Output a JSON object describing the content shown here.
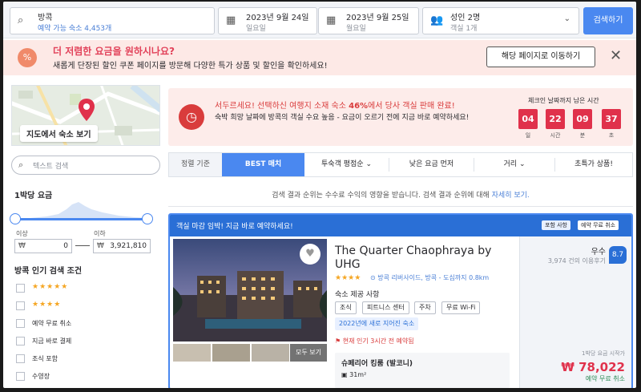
{
  "search": {
    "destination": "방콕",
    "destination_sub": "예약 가능 숙소 4,453개",
    "checkin": "2023년 9월 24일",
    "checkin_day": "일요일",
    "checkout": "2023년 9월 25일",
    "checkout_day": "월요일",
    "guests": "성인 2명",
    "rooms": "객실 1개",
    "button": "검색하기"
  },
  "promo": {
    "title": "더 저렴한 요금을 원하시나요?",
    "text": "새롭게 단장된 할인 쿠폰 페이지를 방문해 다양한 특가 상품 및 할인을 확인하세요!",
    "button": "해당 페이지로 이동하기"
  },
  "sidebar": {
    "map_label": "지도에서 숙소 보기",
    "search_placeholder": "텍스트 검색",
    "price_title": "1박당 요금",
    "min_label": "이상",
    "max_label": "이하",
    "currency": "₩",
    "min_value": "0",
    "max_value": "3,921,810",
    "popular_title": "방콕 인기 검색 조건",
    "filters": [
      {
        "label": "",
        "stars": "★★★★★"
      },
      {
        "label": "",
        "stars": "★★★★"
      },
      {
        "label": "예약 무료 취소",
        "stars": ""
      },
      {
        "label": "지금 바로 결제",
        "stars": ""
      },
      {
        "label": "조식 포함",
        "stars": ""
      },
      {
        "label": "수영장",
        "stars": ""
      }
    ]
  },
  "urgency": {
    "title_prefix": "서두르세요! 선택하신 여행지 소재 숙소 ",
    "title_pct": "46%",
    "title_suffix": "에서 당사 객실 판매 완료!",
    "text": "숙박 희망 날짜에 방콕의 객실 수요 높음 - 요금이 오르기 전에 지금 바로 예약하세요!",
    "countdown_title": "체크인 날짜까지 남은 시간",
    "countdown": [
      {
        "value": "04",
        "unit": "일"
      },
      {
        "value": "22",
        "unit": "시간"
      },
      {
        "value": "09",
        "unit": "분"
      },
      {
        "value": "37",
        "unit": "초"
      }
    ]
  },
  "sort": {
    "label": "정렬 기준",
    "tabs": [
      "BEST 매치",
      "투숙객 평점순",
      "낮은 요금 먼저",
      "거리",
      "초특가 상품!"
    ],
    "active_index": 0
  },
  "note": {
    "text": "검색 결과 순위는 수수료 수익의 영향을 받습니다. 검색 결과 순위에 대해 ",
    "link": "자세히 보기."
  },
  "hotel": {
    "banner": "객실 마감 임박! 지금 바로 예약하세요!",
    "pill_included": "포함 사항",
    "pill_free_cancel": "예약 무료 취소",
    "name_line1": "The Quarter Chaophraya by",
    "name_line2": "UHG",
    "stars": "★★★★",
    "location": "방콕 리버사이드, 방콕 - 도심까지 0.8km",
    "facilities_title": "숙소 제공 사항",
    "facilities": [
      "조식",
      "피트니스 센터",
      "주차",
      "무료 Wi-Fi"
    ],
    "built": "2022년에 새로 지어진 숙소",
    "popular": "현재 인기 3시간 전 예약됨",
    "view_all_photos": "모두 보기",
    "room_name": "슈페리어 킹룸 (발코니)",
    "room_size": "31m²",
    "grade": "우수",
    "reviews": "3,974 건의 이용후기",
    "score": "8.7",
    "price_caption": "1박당 요금 시작가",
    "price_currency": "₩",
    "price": "₩ 78,022",
    "free_cancel": "예약 무료 취소"
  },
  "colors": {
    "accent": "#4a88f0",
    "banner_blue": "#2a6fd6",
    "alert_red": "#e0314b",
    "promo_bg": "#fde9e6"
  }
}
